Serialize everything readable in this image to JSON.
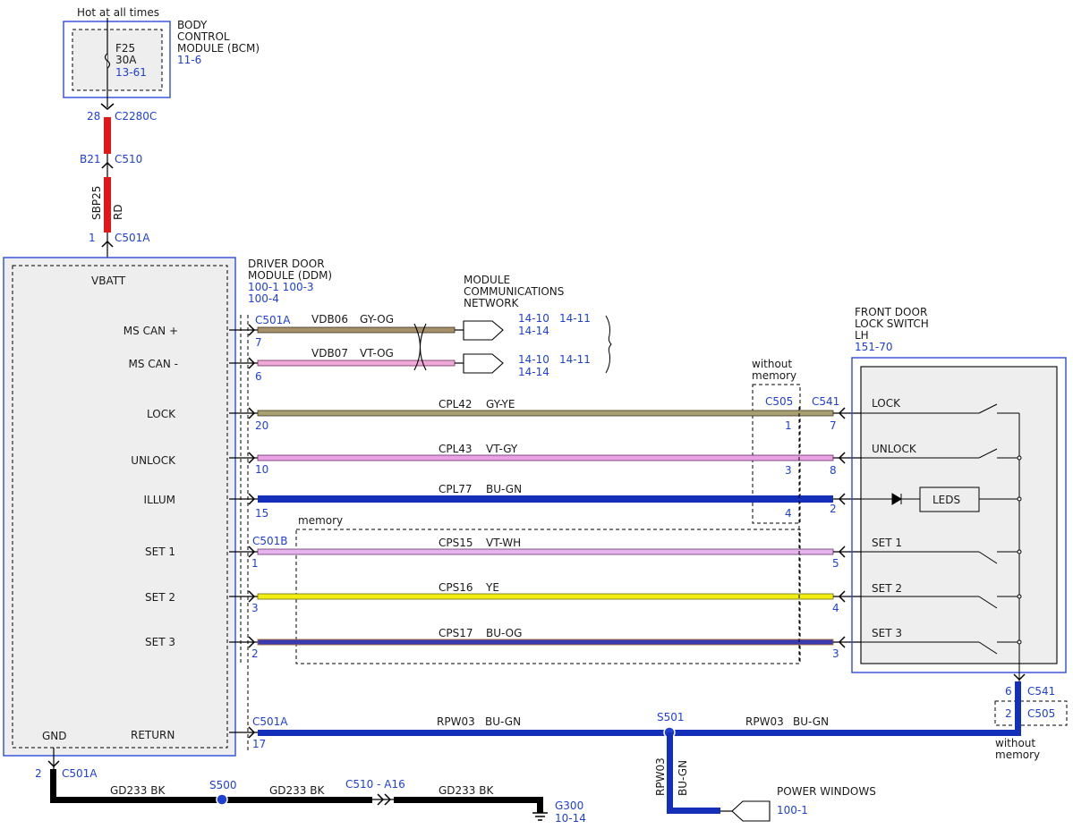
{
  "colors": {
    "ref_blue": "#1f3fd6",
    "box_blue": "#2b4ddb",
    "module_fill": "#eeeeee",
    "wire_red": "#e01818",
    "wire_black": "#000000",
    "wire_blue": "#1538c8",
    "wire_gy_og": "#a5906a",
    "wire_vt_og": "#f0a8d8",
    "wire_gy_ye": "#a8a070",
    "wire_vt_gy": "#e9a3e3",
    "wire_bu_gn": "#1430bb",
    "wire_vt_wh": "#e7b3ec",
    "wire_ye": "#f2ee12",
    "wire_bu_og": "#3a3ab0",
    "splice_blue": "#1f3fd6"
  },
  "bcm": {
    "supply_note": "Hot at all times",
    "name_lines": [
      "BODY",
      "CONTROL",
      "MODULE (BCM)"
    ],
    "ref": "11-6",
    "fuse_name": "F25",
    "fuse_rating": "30A",
    "fuse_ref": "13-61"
  },
  "feed": {
    "c2280c_pin": "28",
    "c2280c": "C2280C",
    "c510_pin": "B21",
    "c510": "C510",
    "circuit": "SBP25",
    "color": "RD",
    "c501a_pin": "1",
    "c501a": "C501A"
  },
  "ddm": {
    "name_lines": [
      "DRIVER DOOR",
      "MODULE (DDM)"
    ],
    "refs": [
      "100-1 100-3",
      "100-4"
    ],
    "terminals": {
      "vbatt": "VBATT",
      "ms_can_plus": "MS CAN +",
      "ms_can_minus": "MS CAN -",
      "lock": "LOCK",
      "unlock": "UNLOCK",
      "illum": "ILLUM",
      "set1": "SET 1",
      "set2": "SET 2",
      "set3": "SET 3",
      "gnd": "GND",
      "return": "RETURN"
    }
  },
  "network": {
    "name_lines": [
      "MODULE",
      "COMMUNICATIONS",
      "NETWORK"
    ],
    "can_plus_refs": [
      "14-10",
      "14-11",
      "14-14"
    ],
    "can_minus_refs": [
      "14-10",
      "14-11",
      "14-14"
    ]
  },
  "wires": {
    "can_plus": {
      "connector": "C501A",
      "pin": "7",
      "circuit": "VDB06",
      "color": "GY-OG"
    },
    "can_minus": {
      "pin": "6",
      "circuit": "VDB07",
      "color": "VT-OG"
    },
    "lock": {
      "pin": "20",
      "circuit": "CPL42",
      "color": "GY-YE",
      "c505_pin": "1",
      "c541_pin": "7"
    },
    "unlock": {
      "pin": "10",
      "circuit": "CPL43",
      "color": "VT-GY",
      "c505_pin": "3",
      "c541_pin": "8"
    },
    "illum": {
      "pin": "15",
      "circuit": "CPL77",
      "color": "BU-GN",
      "c505_pin": "4",
      "c541_pin": "2"
    },
    "set1": {
      "connector": "C501B",
      "pin": "1",
      "circuit": "CPS15",
      "color": "VT-WH",
      "c541_pin": "5"
    },
    "set2": {
      "pin": "3",
      "circuit": "CPS16",
      "color": "YE",
      "c541_pin": "4"
    },
    "set3": {
      "pin": "2",
      "circuit": "CPS17",
      "color": "BU-OG",
      "c541_pin": "3"
    },
    "return": {
      "connector": "C501A",
      "pin": "17",
      "circuit": "RPW03",
      "color": "BU-GN",
      "splice": "S501",
      "right_circuit": "RPW03",
      "right_color": "BU-GN"
    },
    "power_windows": {
      "circuit": "RPW03",
      "color": "BU-GN"
    }
  },
  "without_memory": {
    "label_lines": [
      "without",
      "memory"
    ],
    "c505": "C505",
    "c541": "C541"
  },
  "memory": {
    "label": "memory"
  },
  "lock_switch": {
    "name_lines": [
      "FRONT DOOR",
      "LOCK SWITCH",
      "LH"
    ],
    "ref": "151-70",
    "switches": {
      "lock": "LOCK",
      "unlock": "UNLOCK",
      "leds": "LEDS",
      "set1": "SET 1",
      "set2": "SET 2",
      "set3": "SET 3"
    },
    "bottom_pin": "6",
    "bottom_connector": "C541",
    "c505_pin": "2",
    "c505": "C505",
    "without_memory_lines": [
      "without",
      "memory"
    ]
  },
  "ground": {
    "pin": "2",
    "connector": "C501A",
    "circuit1": "GD233  BK",
    "splice": "S500",
    "circuit2": "GD233  BK",
    "inline_connector": "C510 - A16",
    "circuit3": "GD233  BK",
    "ground_point": "G300",
    "ground_ref": "10-14"
  },
  "power_windows": {
    "label": "POWER WINDOWS",
    "ref": "100-1"
  }
}
